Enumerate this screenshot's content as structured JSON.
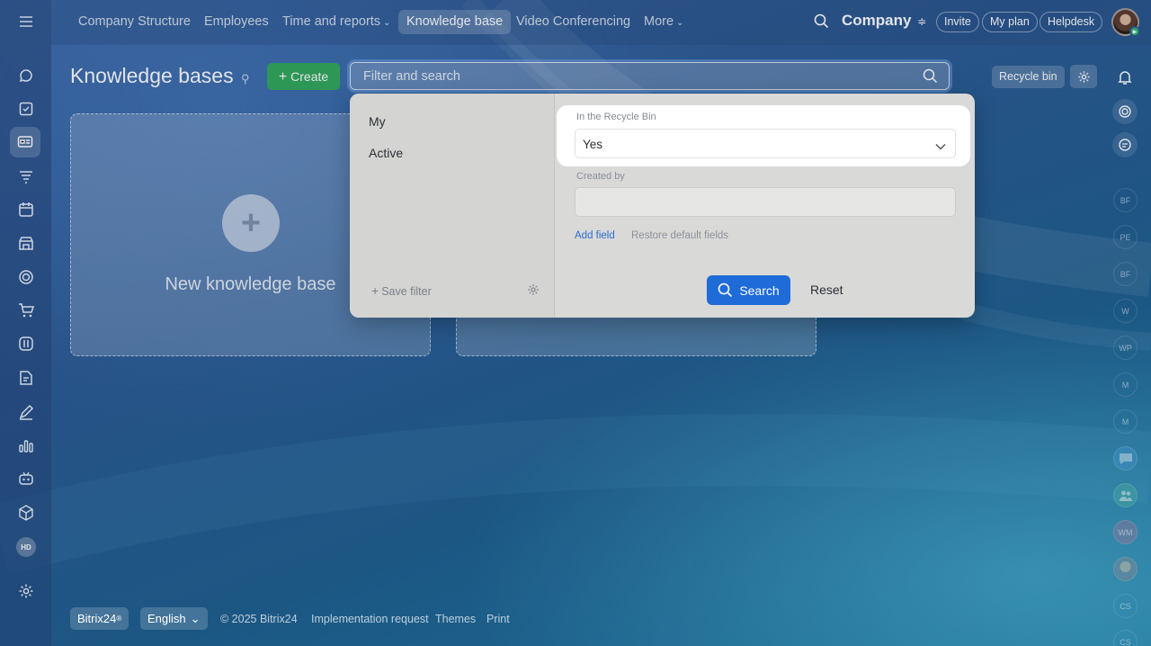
{
  "topnav": {
    "menu_icon": "hamburger-icon",
    "items": [
      {
        "label": "Company Structure"
      },
      {
        "label": "Employees"
      },
      {
        "label": "Time and reports"
      },
      {
        "label": "Knowledge base"
      },
      {
        "label": "Video Conferencing"
      },
      {
        "label": "More"
      }
    ],
    "company": "Company",
    "invite": "Invite",
    "my_plan": "My plan",
    "helpdesk": "Helpdesk"
  },
  "sidebar": {
    "icons": [
      "chat-icon",
      "tasks-icon",
      "sites-icon",
      "crm-icon",
      "calendar-icon",
      "store-icon",
      "goals-icon",
      "cart-icon",
      "workflow-icon",
      "docs-icon",
      "sign-icon",
      "analytics-icon",
      "copilot-icon",
      "inventory-icon",
      "hd-icon",
      "settings-icon"
    ],
    "hd_label": "HD"
  },
  "page": {
    "title": "Knowledge bases",
    "create_label": "Create",
    "filter_placeholder": "Filter and search",
    "recycle_bin": "Recycle bin"
  },
  "cards": {
    "new_label": "New knowledge base"
  },
  "filter_popup": {
    "presets": [
      "My",
      "Active"
    ],
    "save_filter": "Save filter",
    "fields": [
      {
        "label": "In the Recycle Bin",
        "value": "Yes"
      },
      {
        "label": "Created by",
        "value": ""
      }
    ],
    "add_field": "Add field",
    "restore_default": "Restore default fields",
    "search": "Search",
    "reset": "Reset"
  },
  "right_bar": {
    "avatars": [
      "BF",
      "PE",
      "BF",
      "W",
      "WP",
      "M",
      "M",
      "",
      "",
      "WM",
      "",
      "CS",
      "CS"
    ]
  },
  "footer": {
    "brand": "Bitrix24",
    "language": "English",
    "copyright": "© 2025 Bitrix24",
    "implementation": "Implementation request",
    "themes": "Themes",
    "print": "Print"
  }
}
